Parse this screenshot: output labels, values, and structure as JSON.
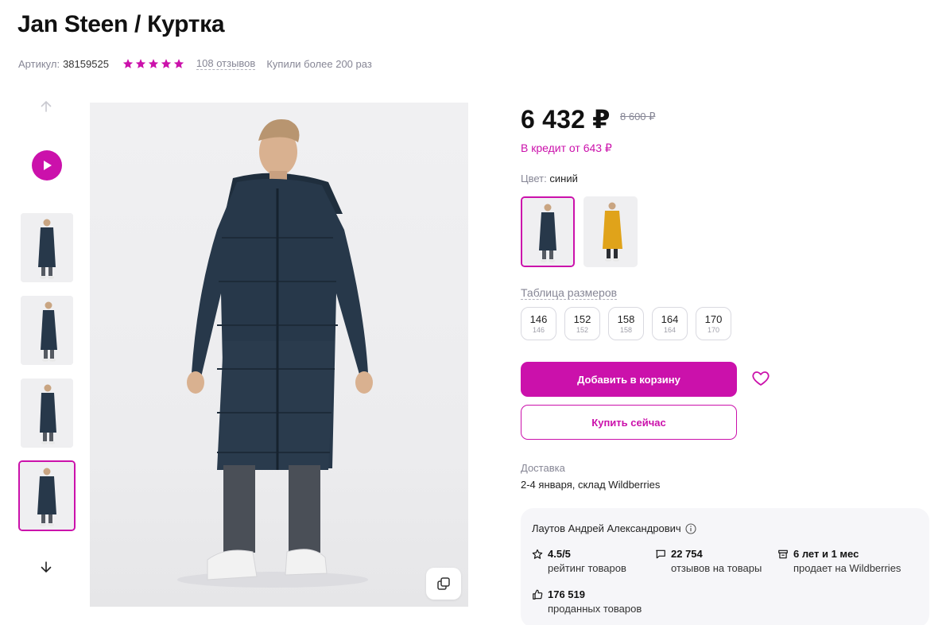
{
  "product": {
    "title": "Jan Steen / Куртка",
    "article_label": "Артикул:",
    "article_value": "38159525",
    "rating_stars": 5,
    "reviews": "108 отзывов",
    "bought": "Купили более 200 раз"
  },
  "gallery": {
    "thumbnails": 4,
    "active_thumbnail": 4
  },
  "price": {
    "current": "6 432 ₽",
    "old": "8 600 ₽",
    "credit": "В кредит от 643 ₽"
  },
  "color": {
    "label": "Цвет:",
    "value": "синий",
    "options": [
      "синий",
      "желтый"
    ]
  },
  "sizes": {
    "label": "Таблица размеров",
    "items": [
      {
        "size": "146",
        "sub": "146"
      },
      {
        "size": "152",
        "sub": "152"
      },
      {
        "size": "158",
        "sub": "158"
      },
      {
        "size": "164",
        "sub": "164"
      },
      {
        "size": "170",
        "sub": "170"
      }
    ]
  },
  "actions": {
    "add_to_cart": "Добавить в корзину",
    "buy_now": "Купить сейчас"
  },
  "delivery": {
    "label": "Доставка",
    "value": "2-4 января, склад Wildberries"
  },
  "seller": {
    "name": "Лаутов Андрей Александрович",
    "stats": [
      {
        "value": "4.5/5",
        "text": "рейтинг товаров",
        "icon": "star-outline-icon"
      },
      {
        "value": "22 754",
        "text": "отзывов на товары",
        "icon": "chat-icon"
      },
      {
        "value": "6 лет и 1 мес",
        "text": "продает на Wildberries",
        "icon": "shop-icon"
      },
      {
        "value": "176 519",
        "text": "проданных товаров",
        "icon": "thumbs-up-icon"
      }
    ]
  },
  "colors": {
    "accent": "#cb11ab",
    "muted": "#868695",
    "jacket_navy": "#27384a",
    "jacket_yellow": "#e0a31a"
  }
}
